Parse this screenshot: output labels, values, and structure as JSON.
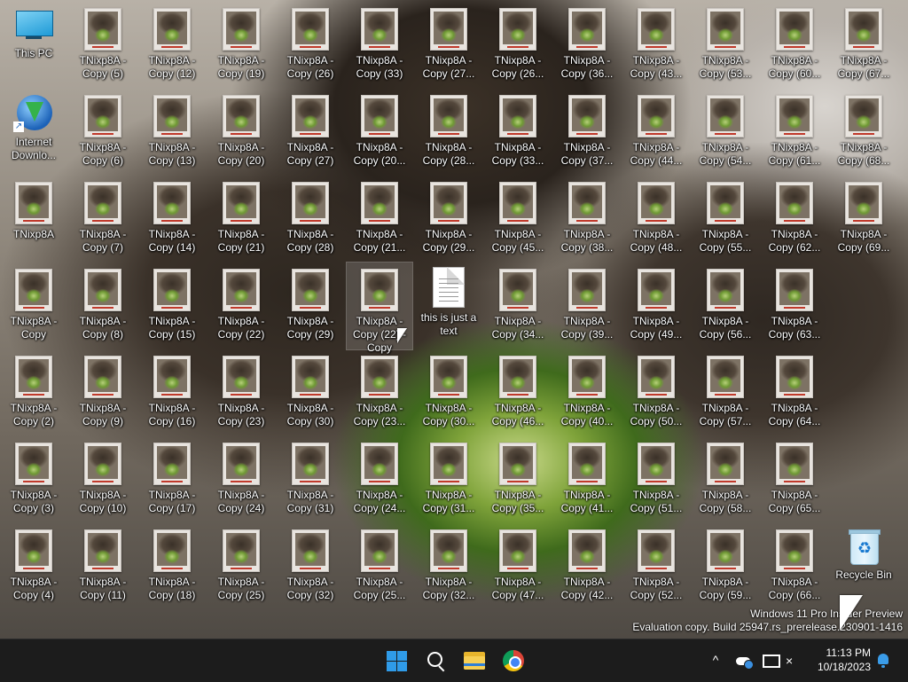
{
  "desktop": {
    "icons": [
      {
        "label": "This PC",
        "type": "this-pc",
        "col": 0,
        "row": 0
      },
      {
        "label": "Internet\nDownlo...",
        "type": "idm",
        "col": 0,
        "row": 1
      },
      {
        "label": "TNixp8A",
        "type": "image",
        "col": 0,
        "row": 2
      },
      {
        "label": "TNixp8A -\nCopy",
        "type": "image",
        "col": 0,
        "row": 3
      },
      {
        "label": "TNixp8A -\nCopy (2)",
        "type": "image",
        "col": 0,
        "row": 4
      },
      {
        "label": "TNixp8A -\nCopy (3)",
        "type": "image",
        "col": 0,
        "row": 5
      },
      {
        "label": "TNixp8A -\nCopy (4)",
        "type": "image",
        "col": 0,
        "row": 6
      },
      {
        "label": "TNixp8A -\nCopy (5)",
        "type": "image",
        "col": 1,
        "row": 0
      },
      {
        "label": "TNixp8A -\nCopy (6)",
        "type": "image",
        "col": 1,
        "row": 1
      },
      {
        "label": "TNixp8A -\nCopy (7)",
        "type": "image",
        "col": 1,
        "row": 2
      },
      {
        "label": "TNixp8A -\nCopy (8)",
        "type": "image",
        "col": 1,
        "row": 3
      },
      {
        "label": "TNixp8A -\nCopy (9)",
        "type": "image",
        "col": 1,
        "row": 4
      },
      {
        "label": "TNixp8A -\nCopy (10)",
        "type": "image",
        "col": 1,
        "row": 5
      },
      {
        "label": "TNixp8A -\nCopy (11)",
        "type": "image",
        "col": 1,
        "row": 6
      },
      {
        "label": "TNixp8A -\nCopy (12)",
        "type": "image",
        "col": 2,
        "row": 0
      },
      {
        "label": "TNixp8A -\nCopy (13)",
        "type": "image",
        "col": 2,
        "row": 1
      },
      {
        "label": "TNixp8A -\nCopy (14)",
        "type": "image",
        "col": 2,
        "row": 2
      },
      {
        "label": "TNixp8A -\nCopy (15)",
        "type": "image",
        "col": 2,
        "row": 3
      },
      {
        "label": "TNixp8A -\nCopy (16)",
        "type": "image",
        "col": 2,
        "row": 4
      },
      {
        "label": "TNixp8A -\nCopy (17)",
        "type": "image",
        "col": 2,
        "row": 5
      },
      {
        "label": "TNixp8A -\nCopy (18)",
        "type": "image",
        "col": 2,
        "row": 6
      },
      {
        "label": "TNixp8A -\nCopy (19)",
        "type": "image",
        "col": 3,
        "row": 0
      },
      {
        "label": "TNixp8A -\nCopy (20)",
        "type": "image",
        "col": 3,
        "row": 1
      },
      {
        "label": "TNixp8A -\nCopy (21)",
        "type": "image",
        "col": 3,
        "row": 2
      },
      {
        "label": "TNixp8A -\nCopy (22)",
        "type": "image",
        "col": 3,
        "row": 3
      },
      {
        "label": "TNixp8A -\nCopy (23)",
        "type": "image",
        "col": 3,
        "row": 4
      },
      {
        "label": "TNixp8A -\nCopy (24)",
        "type": "image",
        "col": 3,
        "row": 5
      },
      {
        "label": "TNixp8A -\nCopy (25)",
        "type": "image",
        "col": 3,
        "row": 6
      },
      {
        "label": "TNixp8A -\nCopy (26)",
        "type": "image",
        "col": 4,
        "row": 0
      },
      {
        "label": "TNixp8A -\nCopy (27)",
        "type": "image",
        "col": 4,
        "row": 1
      },
      {
        "label": "TNixp8A -\nCopy (28)",
        "type": "image",
        "col": 4,
        "row": 2
      },
      {
        "label": "TNixp8A -\nCopy (29)",
        "type": "image",
        "col": 4,
        "row": 3
      },
      {
        "label": "TNixp8A -\nCopy (30)",
        "type": "image",
        "col": 4,
        "row": 4
      },
      {
        "label": "TNixp8A -\nCopy (31)",
        "type": "image",
        "col": 4,
        "row": 5
      },
      {
        "label": "TNixp8A -\nCopy (32)",
        "type": "image",
        "col": 4,
        "row": 6
      },
      {
        "label": "TNixp8A -\nCopy (33)",
        "type": "image",
        "col": 5,
        "row": 0
      },
      {
        "label": "TNixp8A -\nCopy (20...",
        "type": "image",
        "col": 5,
        "row": 1
      },
      {
        "label": "TNixp8A -\nCopy (21...",
        "type": "image",
        "col": 5,
        "row": 2
      },
      {
        "label": "TNixp8A -\nCopy (22) -\nCopy",
        "type": "image",
        "col": 5,
        "row": 3,
        "selected": true
      },
      {
        "label": "TNixp8A -\nCopy (23...",
        "type": "image",
        "col": 5,
        "row": 4
      },
      {
        "label": "TNixp8A -\nCopy (24...",
        "type": "image",
        "col": 5,
        "row": 5
      },
      {
        "label": "TNixp8A -\nCopy (25...",
        "type": "image",
        "col": 5,
        "row": 6
      },
      {
        "label": "TNixp8A -\nCopy (27...",
        "type": "image",
        "col": 6,
        "row": 0
      },
      {
        "label": "TNixp8A -\nCopy (28...",
        "type": "image",
        "col": 6,
        "row": 1
      },
      {
        "label": "TNixp8A -\nCopy (29...",
        "type": "image",
        "col": 6,
        "row": 2
      },
      {
        "label": "this is just a\ntext",
        "type": "text",
        "col": 6,
        "row": 3
      },
      {
        "label": "TNixp8A -\nCopy (30...",
        "type": "image",
        "col": 6,
        "row": 4
      },
      {
        "label": "TNixp8A -\nCopy (31...",
        "type": "image",
        "col": 6,
        "row": 5
      },
      {
        "label": "TNixp8A -\nCopy (32...",
        "type": "image",
        "col": 6,
        "row": 6
      },
      {
        "label": "TNixp8A -\nCopy (26...",
        "type": "image",
        "col": 7,
        "row": 0
      },
      {
        "label": "TNixp8A -\nCopy (33...",
        "type": "image",
        "col": 7,
        "row": 1
      },
      {
        "label": "TNixp8A -\nCopy (45...",
        "type": "image",
        "col": 7,
        "row": 2
      },
      {
        "label": "TNixp8A -\nCopy (34...",
        "type": "image",
        "col": 7,
        "row": 3
      },
      {
        "label": "TNixp8A -\nCopy (46...",
        "type": "image",
        "col": 7,
        "row": 4
      },
      {
        "label": "TNixp8A -\nCopy (35...",
        "type": "image",
        "col": 7,
        "row": 5
      },
      {
        "label": "TNixp8A -\nCopy (47...",
        "type": "image",
        "col": 7,
        "row": 6
      },
      {
        "label": "TNixp8A -\nCopy (36...",
        "type": "image",
        "col": 8,
        "row": 0
      },
      {
        "label": "TNixp8A -\nCopy (37...",
        "type": "image",
        "col": 8,
        "row": 1
      },
      {
        "label": "TNixp8A -\nCopy (38...",
        "type": "image",
        "col": 8,
        "row": 2
      },
      {
        "label": "TNixp8A -\nCopy (39...",
        "type": "image",
        "col": 8,
        "row": 3
      },
      {
        "label": "TNixp8A -\nCopy (40...",
        "type": "image",
        "col": 8,
        "row": 4
      },
      {
        "label": "TNixp8A -\nCopy (41...",
        "type": "image",
        "col": 8,
        "row": 5
      },
      {
        "label": "TNixp8A -\nCopy (42...",
        "type": "image",
        "col": 8,
        "row": 6
      },
      {
        "label": "TNixp8A -\nCopy (43...",
        "type": "image",
        "col": 9,
        "row": 0
      },
      {
        "label": "TNixp8A -\nCopy (44...",
        "type": "image",
        "col": 9,
        "row": 1
      },
      {
        "label": "TNixp8A -\nCopy (48...",
        "type": "image",
        "col": 9,
        "row": 2
      },
      {
        "label": "TNixp8A -\nCopy (49...",
        "type": "image",
        "col": 9,
        "row": 3
      },
      {
        "label": "TNixp8A -\nCopy (50...",
        "type": "image",
        "col": 9,
        "row": 4
      },
      {
        "label": "TNixp8A -\nCopy (51...",
        "type": "image",
        "col": 9,
        "row": 5
      },
      {
        "label": "TNixp8A -\nCopy (52...",
        "type": "image",
        "col": 9,
        "row": 6
      },
      {
        "label": "TNixp8A -\nCopy (53...",
        "type": "image",
        "col": 10,
        "row": 0
      },
      {
        "label": "TNixp8A -\nCopy (54...",
        "type": "image",
        "col": 10,
        "row": 1
      },
      {
        "label": "TNixp8A -\nCopy (55...",
        "type": "image",
        "col": 10,
        "row": 2
      },
      {
        "label": "TNixp8A -\nCopy (56...",
        "type": "image",
        "col": 10,
        "row": 3
      },
      {
        "label": "TNixp8A -\nCopy (57...",
        "type": "image",
        "col": 10,
        "row": 4
      },
      {
        "label": "TNixp8A -\nCopy (58...",
        "type": "image",
        "col": 10,
        "row": 5
      },
      {
        "label": "TNixp8A -\nCopy (59...",
        "type": "image",
        "col": 10,
        "row": 6
      },
      {
        "label": "TNixp8A -\nCopy (60...",
        "type": "image",
        "col": 11,
        "row": 0
      },
      {
        "label": "TNixp8A -\nCopy (61...",
        "type": "image",
        "col": 11,
        "row": 1
      },
      {
        "label": "TNixp8A -\nCopy (62...",
        "type": "image",
        "col": 11,
        "row": 2
      },
      {
        "label": "TNixp8A -\nCopy (63...",
        "type": "image",
        "col": 11,
        "row": 3
      },
      {
        "label": "TNixp8A -\nCopy (64...",
        "type": "image",
        "col": 11,
        "row": 4
      },
      {
        "label": "TNixp8A -\nCopy (65...",
        "type": "image",
        "col": 11,
        "row": 5
      },
      {
        "label": "TNixp8A -\nCopy (66...",
        "type": "image",
        "col": 11,
        "row": 6
      },
      {
        "label": "TNixp8A -\nCopy (67...",
        "type": "image",
        "col": 12,
        "row": 0
      },
      {
        "label": "TNixp8A -\nCopy (68...",
        "type": "image",
        "col": 12,
        "row": 1
      },
      {
        "label": "TNixp8A -\nCopy (69...",
        "type": "image",
        "col": 12,
        "row": 2
      },
      {
        "label": "Recycle Bin",
        "type": "recycle-bin",
        "col": 12,
        "row": 6
      }
    ]
  },
  "watermark": {
    "line1": "Windows 11 Pro Insider Preview",
    "line2": "Evaluation copy. Build 25947.rs_prerelease.230901-1416"
  },
  "taskbar": {
    "apps": [
      {
        "name": "start",
        "icon": "windows-start-icon"
      },
      {
        "name": "search",
        "icon": "search-icon"
      },
      {
        "name": "file-explorer",
        "icon": "folder-icon"
      },
      {
        "name": "chrome",
        "icon": "chrome-icon"
      }
    ],
    "tray": {
      "chevron": "^",
      "volume_glyph": "×",
      "time": "11:13 PM",
      "date": "10/18/2023"
    }
  },
  "colors": {
    "taskbar_bg": "#1c1c1c",
    "accent": "#2f9be8"
  }
}
